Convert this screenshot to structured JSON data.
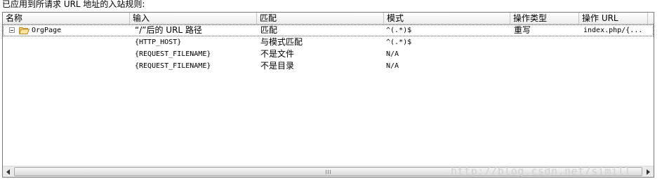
{
  "caption": "已应用到所请求 URL 地址的入站规则:",
  "columns": [
    "名称",
    "输入",
    "匹配",
    "模式",
    "操作类型",
    "操作 URL"
  ],
  "rows": [
    {
      "name": "OrgPage",
      "input": "“/”后的 URL 路径",
      "match": "匹配",
      "pattern": "^(.*)$",
      "action_type": "重写",
      "action_url": "index.php/{..."
    },
    {
      "name": "",
      "input": "{HTTP_HOST}",
      "match": "与模式匹配",
      "pattern": "^(.*)$",
      "action_type": "",
      "action_url": ""
    },
    {
      "name": "",
      "input": "{REQUEST_FILENAME}",
      "match": "不是文件",
      "pattern": "N/A",
      "action_type": "",
      "action_url": ""
    },
    {
      "name": "",
      "input": "{REQUEST_FILENAME}",
      "match": "不是目录",
      "pattern": "N/A",
      "action_type": "",
      "action_url": ""
    }
  ],
  "watermark": "http://blog.csdn.net/simill"
}
